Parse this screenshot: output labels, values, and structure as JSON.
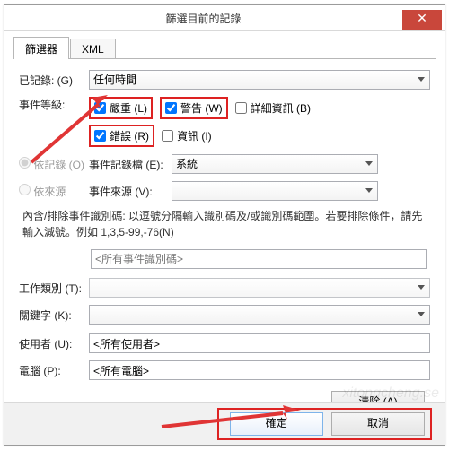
{
  "title": "篩選目前的記錄",
  "tabs": {
    "filter": "篩選器",
    "xml": "XML"
  },
  "labels": {
    "logged": "已記錄: (G)",
    "level": "事件等級:",
    "byLog": "依記錄 (O)",
    "bySource": "依來源",
    "logField": "事件記錄檔 (E):",
    "sourceField": "事件來源 (V):",
    "task": "工作類別 (T):",
    "keyword": "關鍵字 (K):",
    "user": "使用者 (U):",
    "computer": "電腦 (P):"
  },
  "levels": {
    "critical": "嚴重 (L)",
    "warning": "警告 (W)",
    "verbose": "詳細資訊 (B)",
    "error": "錯誤 (R)",
    "info": "資訊 (I)"
  },
  "values": {
    "logged": "任何時間",
    "logField": "系統",
    "sourceField": "",
    "task": "",
    "keyword": "",
    "user": "<所有使用者>",
    "computer": "<所有電腦>",
    "idPlaceholder": "<所有事件識別碼>"
  },
  "helptext": "內含/排除事件識別碼: 以逗號分隔輸入識別碼及/或識別碼範圍。若要排除條件，請先輸入減號。例如 1,3,5-99,-76(N)",
  "buttons": {
    "clear": "清除 (A)",
    "ok": "確定",
    "cancel": "取消"
  },
  "close": "✕",
  "watermark": "xitongcheng.se"
}
